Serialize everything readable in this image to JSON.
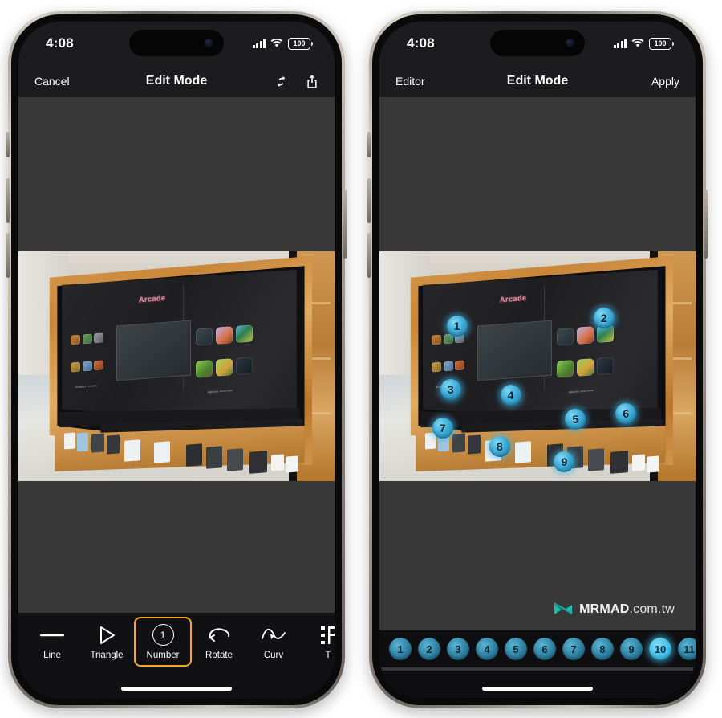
{
  "meta": {
    "watermark_text": "MRMAD",
    "watermark_suffix": ".com.tw",
    "watermark_logo": "mrmad-logo-icon",
    "accent_orange": "#f5a623",
    "accent_cyan": "#3fc0ea",
    "marker_blue": "#2e7f9f"
  },
  "left_phone": {
    "status": {
      "time": "4:08",
      "cellular_icon": "cellular-bars-icon",
      "wifi_icon": "wifi-icon",
      "battery_level": "100"
    },
    "nav": {
      "left_label": "Cancel",
      "title": "Edit Mode",
      "sync_icon": "sync-arrows-icon",
      "share_icon": "share-up-arrow-icon"
    },
    "toolbar": {
      "items": [
        {
          "label": "Line",
          "icon": "line-icon",
          "selected": false,
          "badge": ""
        },
        {
          "label": "Triangle",
          "icon": "triangle-icon",
          "selected": false,
          "badge": ""
        },
        {
          "label": "Number",
          "icon": "number-circle-icon",
          "selected": true,
          "badge": "1"
        },
        {
          "label": "Rotate",
          "icon": "rotate-arrow-icon",
          "selected": false,
          "badge": ""
        },
        {
          "label": "Curv",
          "icon": "curve-arrow-icon",
          "selected": false,
          "badge": ""
        },
        {
          "label": "T",
          "icon": "crop-icon",
          "selected": false,
          "badge": ""
        }
      ]
    }
  },
  "right_phone": {
    "status": {
      "time": "4:08",
      "cellular_icon": "cellular-bars-icon",
      "wifi_icon": "wifi-icon",
      "battery_level": "100"
    },
    "nav": {
      "left_label": "Editor",
      "title": "Edit Mode",
      "right_label": "Apply"
    },
    "markers": [
      {
        "label": "1",
        "x": 24.5,
        "y": 32.5
      },
      {
        "label": "2",
        "x": 71.0,
        "y": 29.0
      },
      {
        "label": "3",
        "x": 22.5,
        "y": 60.0
      },
      {
        "label": "4",
        "x": 41.5,
        "y": 62.5
      },
      {
        "label": "5",
        "x": 62.0,
        "y": 73.0
      },
      {
        "label": "6",
        "x": 78.0,
        "y": 70.5
      },
      {
        "label": "7",
        "x": 20.0,
        "y": 77.0
      },
      {
        "label": "8",
        "x": 38.0,
        "y": 85.0
      },
      {
        "label": "9",
        "x": 58.5,
        "y": 91.5
      }
    ],
    "number_strip": {
      "selected": "10",
      "chips": [
        "1",
        "2",
        "3",
        "4",
        "5",
        "6",
        "7",
        "8",
        "9",
        "10",
        "11"
      ]
    }
  },
  "photo": {
    "wall_logo": "Arcade",
    "wall_caption": "Appuyez pour jouer",
    "wall_caption_left": "Essayez les jeux"
  }
}
